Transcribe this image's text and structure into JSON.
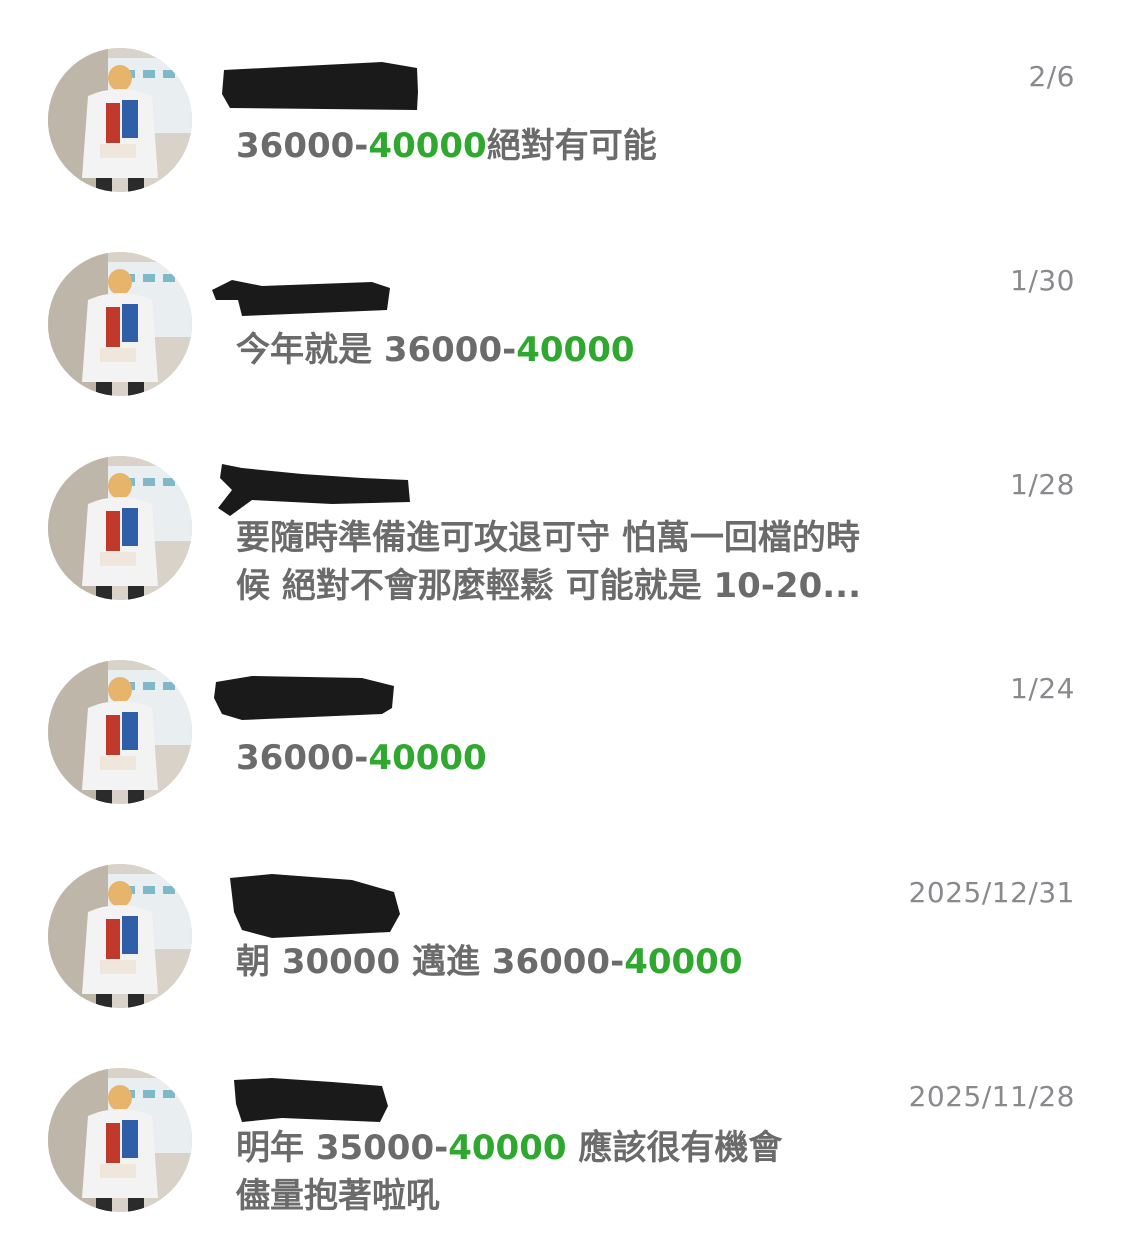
{
  "colors": {
    "accent_green": "#2ea82e",
    "text_gray": "#6b6b6b",
    "date_gray": "#8a8a8e",
    "redaction": "#1a1a1a"
  },
  "comments": [
    {
      "date": "2/6",
      "avatar": "avatar-photo",
      "name_redacted": true,
      "line1": {
        "pre": "36000-",
        "hl": "40000",
        "post": "絕對有可能"
      },
      "line2": ""
    },
    {
      "date": "1/30",
      "avatar": "avatar-photo",
      "name_redacted": true,
      "line1": {
        "pre": "今年就是 36000-",
        "hl": "40000",
        "post": ""
      },
      "line2": ""
    },
    {
      "date": "1/28",
      "avatar": "avatar-photo",
      "name_redacted": true,
      "line1": {
        "pre": "要隨時準備進可攻退可守 怕萬一回檔的時",
        "hl": "",
        "post": ""
      },
      "line2": "候 絕對不會那麼輕鬆 可能就是 10-20..."
    },
    {
      "date": "1/24",
      "avatar": "avatar-photo",
      "name_redacted": true,
      "line1": {
        "pre": "36000-",
        "hl": "40000",
        "post": ""
      },
      "line2": ""
    },
    {
      "date": "2025/12/31",
      "avatar": "avatar-photo",
      "name_redacted": true,
      "line1": {
        "pre": "朝 30000 邁進 36000-",
        "hl": "40000",
        "post": ""
      },
      "line2": ""
    },
    {
      "date": "2025/11/28",
      "avatar": "avatar-photo",
      "name_redacted": true,
      "line1": {
        "pre": "明年 35000-",
        "hl": "40000",
        "post": "  應該很有機會"
      },
      "line2": "儘量抱著啦吼"
    }
  ]
}
